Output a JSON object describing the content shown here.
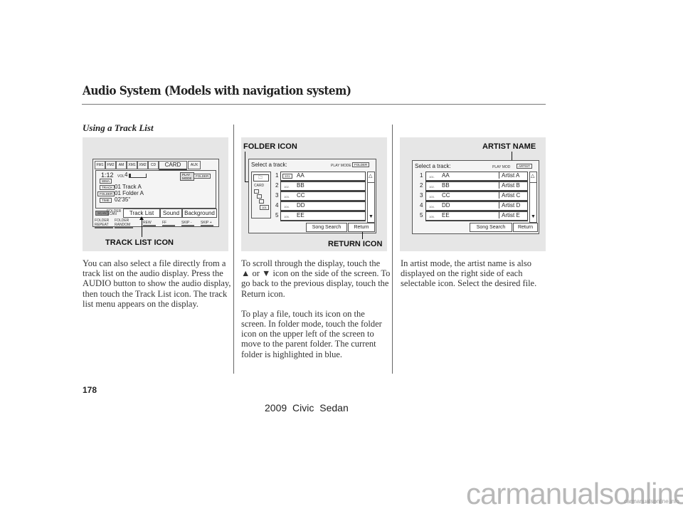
{
  "header": {
    "title": "Audio System (Models with navigation system)",
    "subtitle": "Using a Track List"
  },
  "figure1": {
    "source_tabs": [
      "FM1",
      "FM2",
      "AM",
      "XM1",
      "XM2",
      "CD",
      "CARD",
      "AUX"
    ],
    "active_tab": "CARD",
    "time": "1:12",
    "vol_label": "VOL",
    "vol_value": "4",
    "format_badge": "WMA",
    "play_mode": "PLAY MODE",
    "folder_badge": "FOLDER",
    "track_label": "TRACK",
    "track_value": "01  Track A",
    "folder_label": "FOLDER",
    "folder_value": "01  Folder A",
    "time_label": "TIME",
    "time_value": "02'35\"",
    "scan_label": "SCAN",
    "folder_scan_label": "FOLDER SCAN",
    "buttons": [
      "Track List",
      "Sound",
      "Background"
    ],
    "bottom_buttons": [
      "FOLDER REPEAT",
      "FOLDER RANDOM",
      "REW",
      "FF",
      "SKIP -",
      "SKIP +"
    ],
    "callout": "TRACK LIST ICON"
  },
  "figure2": {
    "callout_top": "FOLDER ICON",
    "callout_bottom": "RETURN ICON",
    "heading": "Select a track:",
    "play_mode": "PLAY MODE",
    "mode_badge": "FOLDER",
    "tree_card": "CARD",
    "tree_folder": "101",
    "tracks": [
      {
        "num": "1",
        "idx": "101",
        "name": "AA"
      },
      {
        "num": "2",
        "idx": "102.",
        "name": "BB"
      },
      {
        "num": "3",
        "idx": "103.",
        "name": "CC"
      },
      {
        "num": "4",
        "idx": "104.",
        "name": "DD"
      },
      {
        "num": "5",
        "idx": "105.",
        "name": "EE"
      }
    ],
    "song_search": "Song Search",
    "return": "Return",
    "scroll_up": "△",
    "scroll_down": "▼"
  },
  "figure3": {
    "callout": "ARTIST NAME",
    "heading": "Select a track:",
    "play_mode": "PLAY MOD",
    "mode_badge": "ARTIST",
    "tracks": [
      {
        "num": "1",
        "idx": "101.",
        "name": "AA",
        "artist": "Artist A"
      },
      {
        "num": "2",
        "idx": "102.",
        "name": "BB",
        "artist": "Artist B"
      },
      {
        "num": "3",
        "idx": "103.",
        "name": "CC",
        "artist": "Artist C"
      },
      {
        "num": "4",
        "idx": "104.",
        "name": "DD",
        "artist": "Artist D"
      },
      {
        "num": "5",
        "idx": "105.",
        "name": "EE",
        "artist": "Artist E"
      }
    ],
    "song_search": "Song Search",
    "return": "Return",
    "scroll_up": "△",
    "scroll_down": "▼"
  },
  "columns": {
    "col1": [
      "You can also select a file directly from a track list on the audio display. Press the AUDIO button to show the audio display, then touch the Track List icon. The track list menu appears on the display."
    ],
    "col2_p1_a": "To scroll through the display, touch the",
    "col2_up": "▲",
    "col2_or": "or",
    "col2_down": "▼",
    "col2_p1_b": "icon on the side of the screen. To go back to the previous display, touch the Return icon.",
    "col2_p2": "To play a file, touch its icon on the screen. In folder mode, touch the folder icon on the upper left of the screen to move to the parent folder. The current folder is highlighted in blue.",
    "col3": "In artist mode, the artist name is also displayed on the right side of each selectable icon. Select the desired file."
  },
  "footer": {
    "page_number": "178",
    "model": "2009  Civic  Sedan",
    "watermark": "carmanualsonline.info",
    "watermark_small": "carmanualsonline.info"
  }
}
